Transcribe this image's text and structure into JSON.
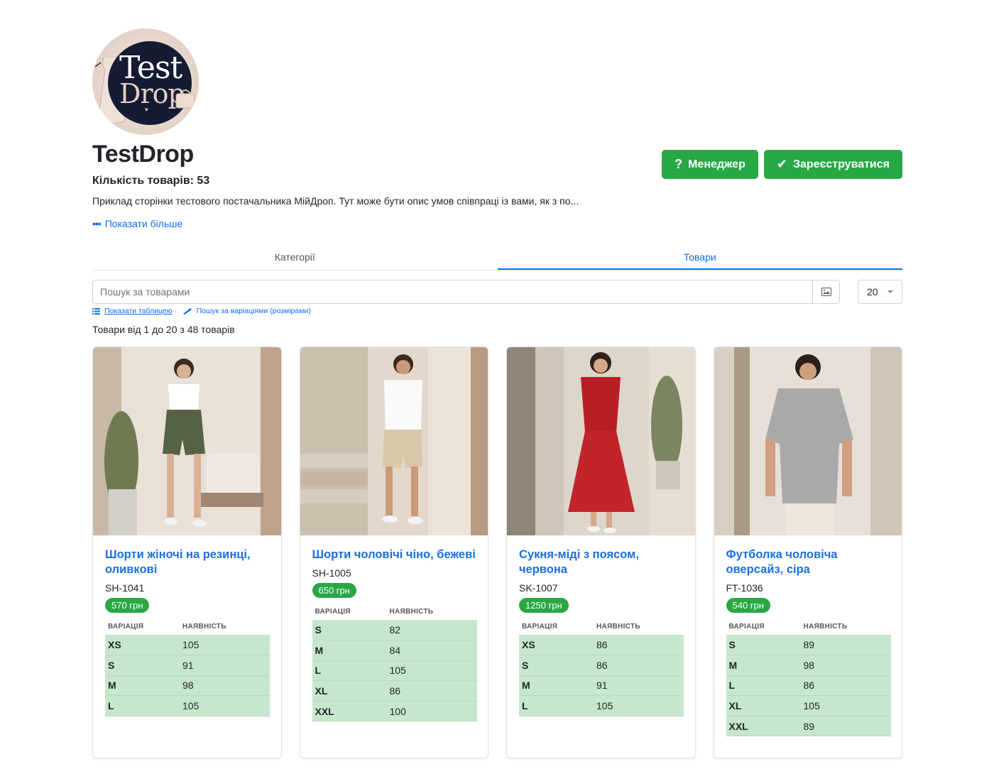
{
  "supplier": {
    "logo_text_1": "Test",
    "logo_text_2": "Drop",
    "name": "TestDrop",
    "count_label": "Кількість товарів: 53",
    "description": "Приклад сторінки тестового постачальника МійДроп. Тут може бути опис умов співпраці із вами, як з по...",
    "show_more": "Показати більше"
  },
  "actions": {
    "manager": "Менеджер",
    "register": "Зареєструватися"
  },
  "tabs": [
    {
      "label": "Категорії",
      "active": false
    },
    {
      "label": "Товари",
      "active": true
    }
  ],
  "search": {
    "placeholder": "Пошук за товарами",
    "per_page": "20"
  },
  "links": {
    "table": "Показати таблицею",
    "variations": "Пошук за варіаціями (розмірами)"
  },
  "shown_label": "Товари від 1 до 20 з 48 товарів",
  "table_headers": {
    "variation": "ВАРІАЦІЯ",
    "stock": "НАЯВНІСТЬ"
  },
  "products": [
    {
      "name": "Шорти жіночі на резинці, оливкові",
      "sku": "SH-1041",
      "price": "570 грн",
      "variations": [
        [
          "XS",
          "105"
        ],
        [
          "S",
          "91"
        ],
        [
          "M",
          "98"
        ],
        [
          "L",
          "105"
        ]
      ]
    },
    {
      "name": "Шорти чоловічі чіно, бежеві",
      "sku": "SH-1005",
      "price": "650 грн",
      "variations": [
        [
          "S",
          "82"
        ],
        [
          "M",
          "84"
        ],
        [
          "L",
          "105"
        ],
        [
          "XL",
          "86"
        ],
        [
          "XXL",
          "100"
        ]
      ]
    },
    {
      "name": "Сукня-міді з поясом, червона",
      "sku": "SK-1007",
      "price": "1250 грн",
      "variations": [
        [
          "XS",
          "86"
        ],
        [
          "S",
          "86"
        ],
        [
          "M",
          "91"
        ],
        [
          "L",
          "105"
        ]
      ]
    },
    {
      "name": "Футболка чоловіча оверсайз, сіра",
      "sku": "FT-1036",
      "price": "540 грн",
      "variations": [
        [
          "S",
          "89"
        ],
        [
          "M",
          "98"
        ],
        [
          "L",
          "86"
        ],
        [
          "XL",
          "105"
        ],
        [
          "XXL",
          "89"
        ]
      ]
    }
  ],
  "colors": {
    "accent": "#0d6efd",
    "success": "#28a745",
    "stock_row": "#c7e7cc"
  }
}
